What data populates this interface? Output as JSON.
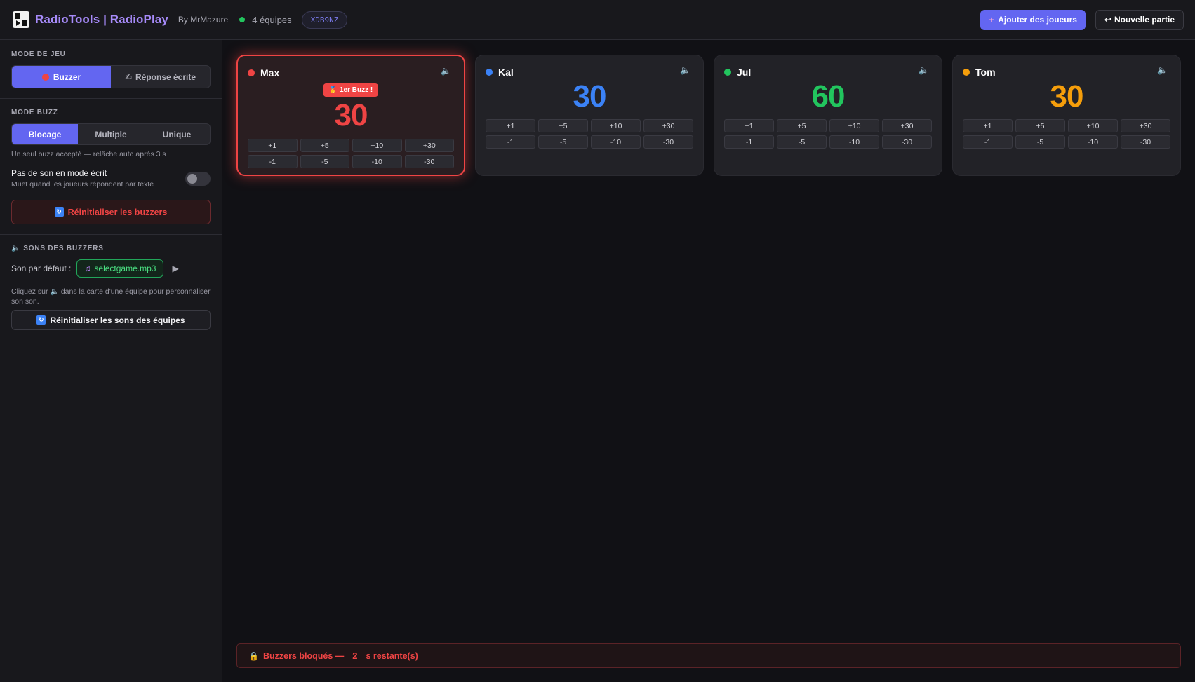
{
  "header": {
    "brand": "RadioTools | RadioPlay",
    "byline": "By MrMazure",
    "team_count": "4 équipes",
    "room_code": "XDB9NZ",
    "add_players_label": "Ajouter des joueurs",
    "new_game_label": "Nouvelle partie",
    "colors": {
      "accent": "#6366f1",
      "online": "#22c55e"
    }
  },
  "sidebar": {
    "game_mode": {
      "title": "MODE DE JEU",
      "options": [
        "Buzzer",
        "Réponse écrite"
      ],
      "selected": "Buzzer"
    },
    "buzz_mode": {
      "title": "MODE BUZZ",
      "options": [
        "Blocage",
        "Multiple",
        "Unique"
      ],
      "selected": "Blocage",
      "hint": "Un seul buzz accepté — relâche auto après 3 s"
    },
    "mute_written": {
      "title": "Pas de son en mode écrit",
      "subtitle": "Muet quand les joueurs répondent par texte",
      "enabled": false
    },
    "reset_buzzers_label": "Réinitialiser les buzzers",
    "sounds": {
      "title": "SONS DES BUZZERS",
      "default_label": "Son par défaut :",
      "default_file": "selectgame.mp3",
      "hint_before": "Cliquez sur",
      "hint_after": "dans la carte d'une équipe pour personnaliser son son.",
      "reset_sounds_label": "Réinitialiser les sons des équipes"
    }
  },
  "teams": [
    {
      "name": "Max",
      "color": "#ef4444",
      "score": "30",
      "buzzed": true,
      "badge": "1er Buzz !"
    },
    {
      "name": "Kal",
      "color": "#3b82f6",
      "score": "30",
      "buzzed": false
    },
    {
      "name": "Jul",
      "color": "#22c55e",
      "score": "60",
      "buzzed": false
    },
    {
      "name": "Tom",
      "color": "#f59e0b",
      "score": "30",
      "buzzed": false
    }
  ],
  "score_buttons": [
    "+1",
    "+5",
    "+10",
    "+30",
    "-1",
    "-5",
    "-10",
    "-30"
  ],
  "status": {
    "prefix": "Buzzers bloqués —",
    "seconds": "2",
    "suffix": "s restante(s)"
  }
}
